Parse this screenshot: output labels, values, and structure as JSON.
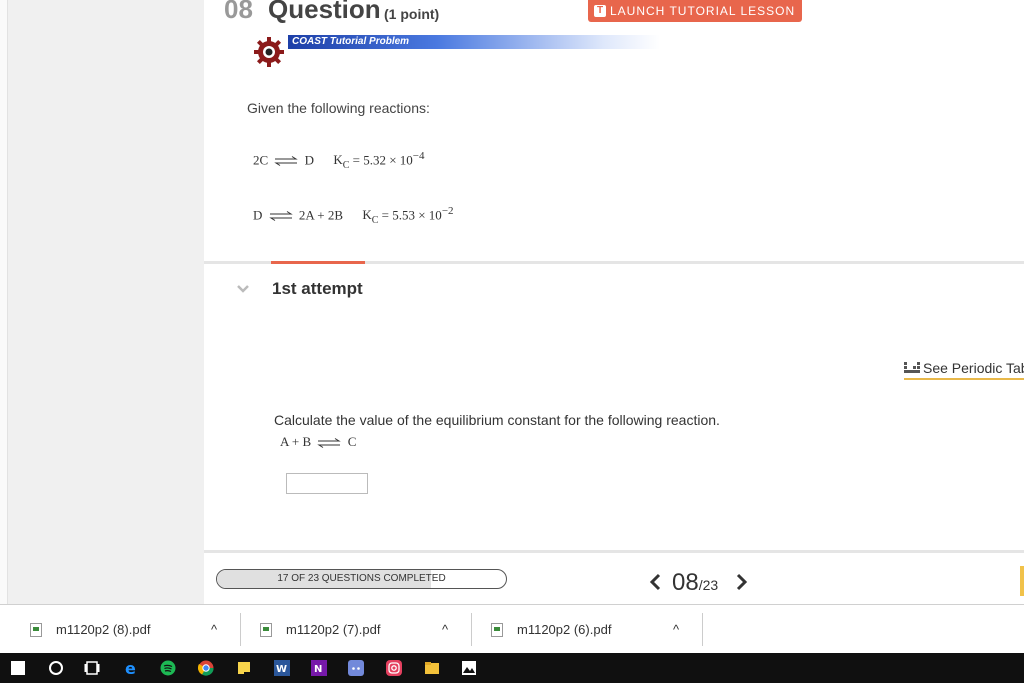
{
  "question": {
    "number": "08",
    "word": "Question",
    "points": "(1 point)",
    "launch_button": "LAUNCH TUTORIAL LESSON",
    "launch_icon": "T",
    "banner": "COAST Tutorial Problem",
    "given": "Given the following reactions:",
    "reaction1": {
      "left": "2C",
      "right": "D",
      "k": "K",
      "k_sub": "C",
      "k_val": "= 5.32 × 10",
      "k_exp": "−4"
    },
    "reaction2": {
      "left": "D",
      "right": "2A + 2B",
      "k": "K",
      "k_sub": "C",
      "k_val": "= 5.53 × 10",
      "k_exp": "−2"
    }
  },
  "attempt": {
    "label": "1st attempt",
    "periodic_link": "See Periodic Tab",
    "prompt": "Calculate the value of the equilibrium constant for the following reaction.",
    "target_reaction": {
      "left": "A + B",
      "right": "C"
    },
    "answer_value": ""
  },
  "footer": {
    "progress_text": "17 OF 23 QUESTIONS COMPLETED",
    "progress_fraction": 0.74,
    "current": "08",
    "total": "/23"
  },
  "downloads": [
    {
      "name": "m1120p2 (8).pdf"
    },
    {
      "name": "m1120p2 (7).pdf"
    },
    {
      "name": "m1120p2 (6).pdf"
    }
  ],
  "taskbar": {
    "icons": [
      "windows-start-icon",
      "cortana-search-icon",
      "task-view-icon",
      "edge-icon",
      "spotify-icon",
      "chrome-icon",
      "sticky-notes-icon",
      "word-icon",
      "onenote-icon",
      "discord-icon",
      "instagram-icon",
      "file-explorer-icon",
      "photos-icon"
    ]
  },
  "colors": {
    "accent": "#e8664c",
    "banner_blue": "#1d3fa8",
    "periodic_underline": "#e8b84a"
  }
}
